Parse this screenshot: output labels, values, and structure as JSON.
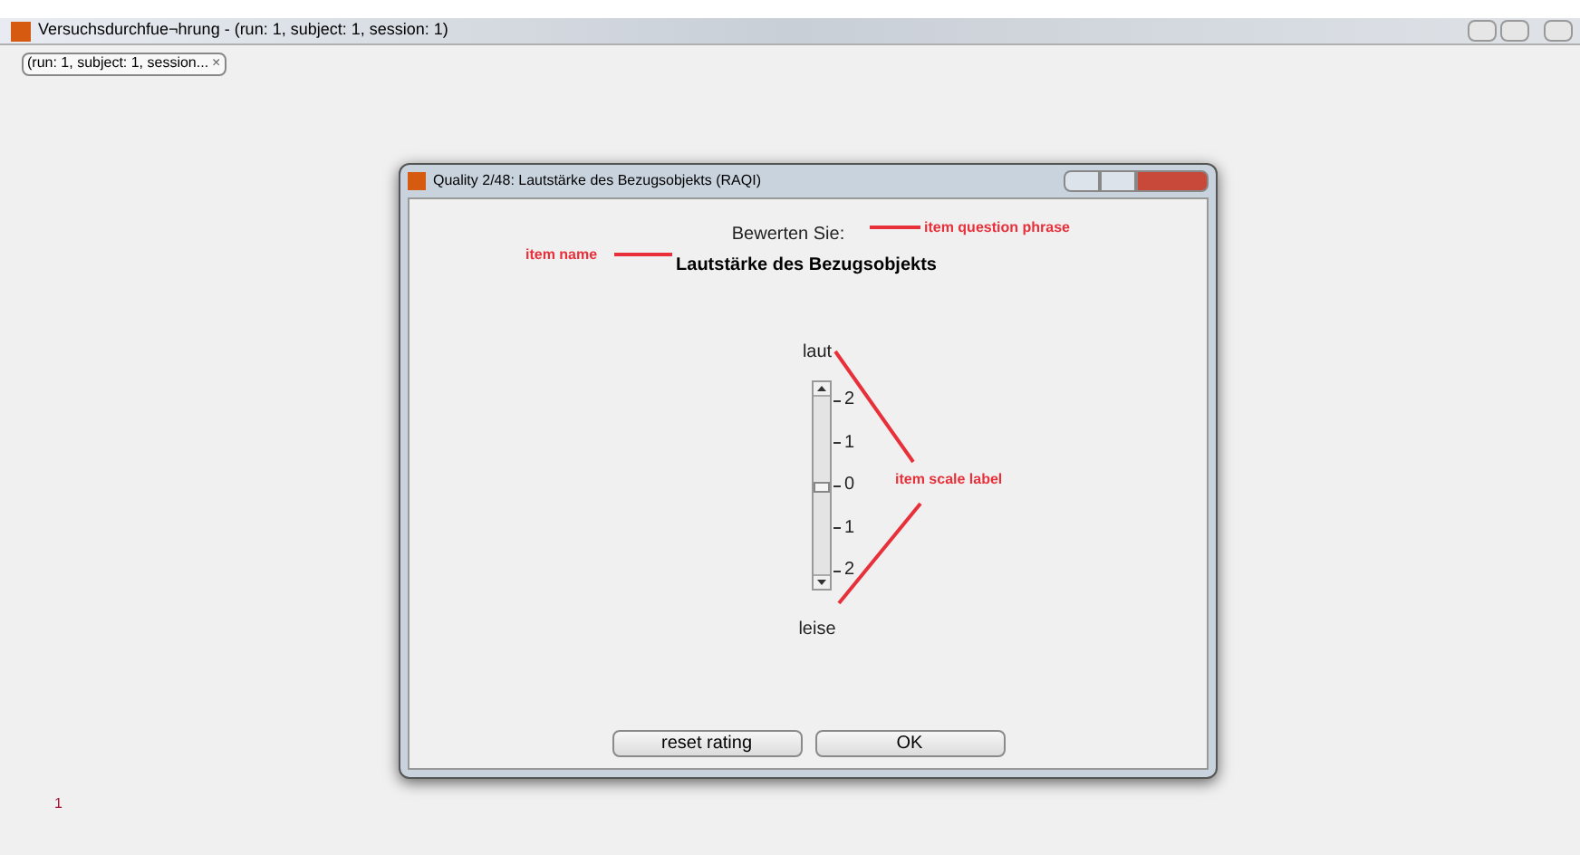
{
  "window": {
    "title": "Versuchsdurchfue¬hrung - (run: 1,  subject: 1,  session: 1)"
  },
  "tabs": [
    {
      "label": "(run: 1,  subject: 1,  session...",
      "close": "×",
      "selected": true
    }
  ],
  "dialog": {
    "title": "Quality 2/48: Lautstärke des Bezugsobjekts (RAQI)",
    "question": "Bewerten Sie:",
    "item_name": "Lautstärke des Bezugsobjekts",
    "scale": {
      "top_label": "laut",
      "bottom_label": "leise",
      "ticks": [
        "2",
        "1",
        "0",
        "1",
        "2"
      ],
      "level": 0.5
    },
    "buttons": [
      "reset rating",
      "OK"
    ]
  },
  "annotations": {
    "question": "item question phrase",
    "name": "item name",
    "scale": "item scale label"
  },
  "footer": "1"
}
